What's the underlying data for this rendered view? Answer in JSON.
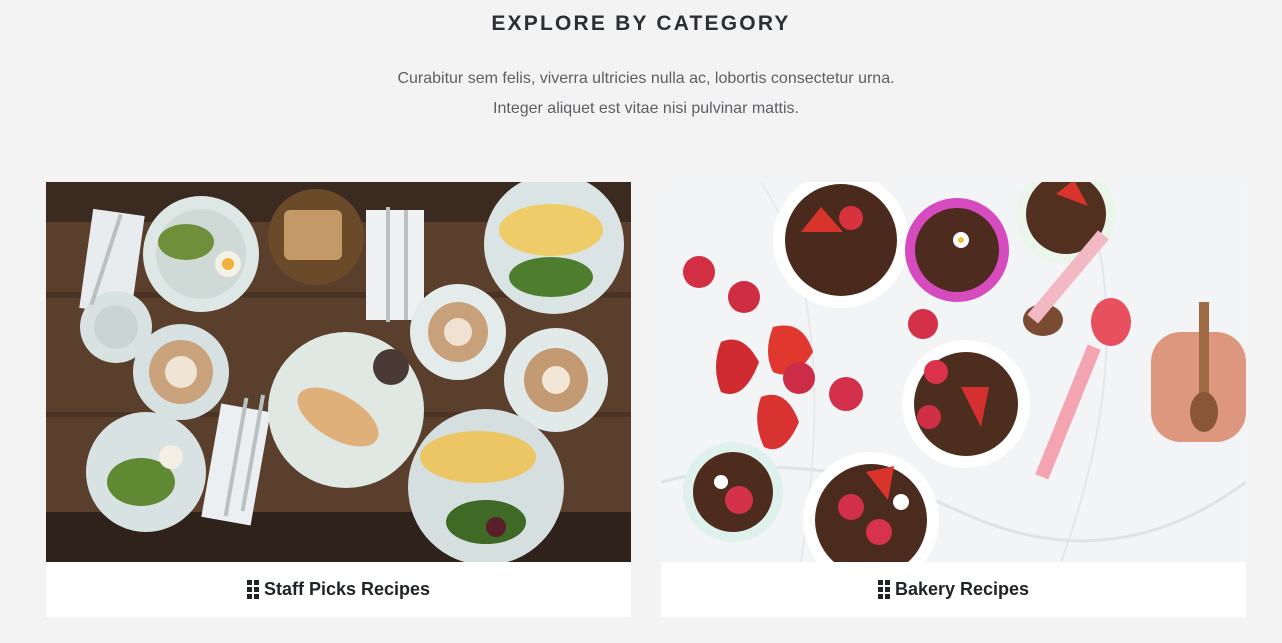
{
  "section": {
    "title": "EXPLORE BY CATEGORY",
    "description": "Curabitur sem felis, viverra ultricies nulla ac, lobortis consectetur urna. Integer aliquet est vitae nisi pulvinar mattis."
  },
  "categories": [
    {
      "label": "Staff Picks Recipes",
      "icon": "grid-icon",
      "image": "breakfast-table-photo"
    },
    {
      "label": "Bakery Recipes",
      "icon": "grid-icon",
      "image": "chocolate-strawberry-desserts-photo"
    }
  ],
  "colors": {
    "background": "#f3f3f3",
    "card": "#ffffff",
    "heading": "#2b2f33",
    "body_text": "#5c5f63"
  }
}
